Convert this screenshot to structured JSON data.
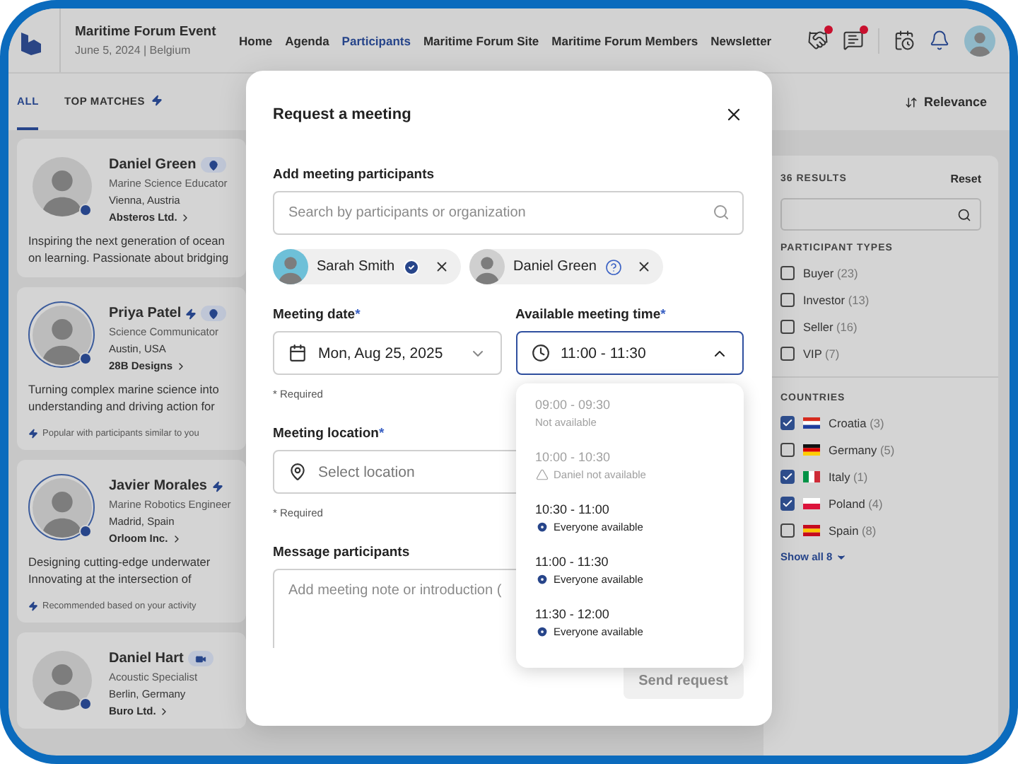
{
  "nav": {
    "title": "Maritime Forum Event",
    "subtitle": "June 5, 2024 | Belgium",
    "links": [
      {
        "label": "Home",
        "selected": false
      },
      {
        "label": "Agenda",
        "selected": false
      },
      {
        "label": "Participants",
        "selected": true
      },
      {
        "label": "Maritime Forum Site",
        "selected": false
      },
      {
        "label": "Maritime Forum Members",
        "selected": false
      },
      {
        "label": "Newsletter",
        "selected": false
      }
    ],
    "icons": [
      {
        "kind": "handshake",
        "notification": true
      },
      {
        "kind": "chat",
        "notification": true
      },
      {
        "kind": "calendar",
        "notification": false
      },
      {
        "kind": "bell",
        "notification": false
      }
    ]
  },
  "tabs": [
    {
      "label": "ALL",
      "selected": true,
      "kind": "plain"
    },
    {
      "label": "TOP MATCHES",
      "selected": false,
      "kind": "matches"
    }
  ],
  "sort": {
    "label": "Relevance"
  },
  "participants": [
    {
      "name": "Daniel Green",
      "featured": false,
      "badges": [
        {
          "kind": "location"
        }
      ],
      "role": "Marine Science Educator",
      "location": "Vienna, Austria",
      "company": "Absteros Ltd.",
      "bio": [
        "Inspiring the next generation of ocean",
        "on learning. Passionate about bridging"
      ]
    },
    {
      "name": "Priya Patel",
      "featured": true,
      "badges": [
        {
          "kind": "location"
        }
      ],
      "role": "Science Communicator",
      "location": "Austin, USA",
      "company": "28B Designs",
      "bio": [
        "Turning complex marine science into",
        "understanding and driving action for"
      ],
      "reason": "Popular with participants similar to you"
    },
    {
      "name": "Javier Morales",
      "featured": true,
      "role": "Marine Robotics Engineer",
      "location": "Madrid, Spain",
      "company": "Orloom Inc.",
      "bio": [
        "Designing cutting-edge underwater",
        "Innovating at the intersection of"
      ],
      "reason": "Recommended based on your activity"
    },
    {
      "name": "Daniel Hart",
      "featured": false,
      "badges": [
        {
          "kind": "video"
        }
      ],
      "role": "Acoustic Specialist",
      "location": "Berlin, Germany",
      "company": "Buro Ltd."
    }
  ],
  "filters": {
    "results": "36 RESULTS",
    "reset": "Reset",
    "sections": [
      {
        "title": "PARTICIPANT TYPES",
        "options": [
          {
            "label": "Buyer",
            "count": "(23)",
            "checked": false
          },
          {
            "label": "Investor",
            "count": "(13)",
            "checked": false
          },
          {
            "label": "Seller",
            "count": "(16)",
            "checked": false
          },
          {
            "label": "VIP",
            "count": "(7)",
            "checked": false
          }
        ]
      },
      {
        "title": "COUNTRIES",
        "options": [
          {
            "label": "Croatia",
            "count": "(3)",
            "checked": true,
            "kind": "croatia"
          },
          {
            "label": "Germany",
            "count": "(5)",
            "checked": false,
            "kind": "germany"
          },
          {
            "label": "Italy",
            "count": "(1)",
            "checked": true,
            "kind": "italy"
          },
          {
            "label": "Poland",
            "count": "(4)",
            "checked": true,
            "kind": "poland"
          },
          {
            "label": "Spain",
            "count": "(8)",
            "checked": false,
            "kind": "spain"
          }
        ]
      }
    ],
    "show_all": "Show all 8"
  },
  "modal": {
    "title": "Request a meeting",
    "participants_label": "Add meeting participants",
    "search_placeholder": "Search by participants or organization",
    "chips": [
      {
        "name": "Sarah Smith",
        "kind": "confirmed"
      },
      {
        "name": "Daniel Green",
        "kind": "pending"
      }
    ],
    "date_label": "Meeting date",
    "date_value": "Mon, Aug 25, 2025",
    "date_note": "* Required",
    "time_label": "Available meeting time",
    "time_value": "11:00 - 11:30",
    "time_expanded": true,
    "time_options": [
      {
        "time": "09:00 - 09:30",
        "status": "Not available",
        "kind": "unavailable"
      },
      {
        "time": "10:00 - 10:30",
        "status": "Daniel not available",
        "kind": "conflict"
      },
      {
        "time": "10:30 - 11:00",
        "status": "Everyone available",
        "kind": "available"
      },
      {
        "time": "11:00 - 11:30",
        "status": "Everyone available",
        "kind": "available"
      },
      {
        "time": "11:30 - 12:00",
        "status": "Everyone available",
        "kind": "available"
      }
    ],
    "required_mark": "*",
    "location_label": "Meeting location",
    "location_placeholder": "Select location",
    "location_note": "* Required",
    "message_label": "Message participants",
    "message_placeholder": "Add meeting note or introduction (",
    "send": {
      "label": "Send request",
      "disabled": true
    }
  }
}
